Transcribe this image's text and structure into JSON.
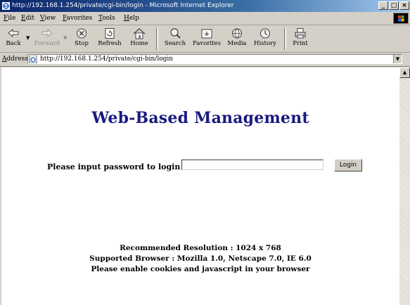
{
  "window": {
    "title": "http://192.168.1.254/private/cgi-bin/login - Microsoft Internet Explorer",
    "minimize": "_",
    "maximize": "□",
    "close": "×"
  },
  "menubar": {
    "items": [
      {
        "first": "F",
        "rest": "ile"
      },
      {
        "first": "E",
        "rest": "dit"
      },
      {
        "first": "V",
        "rest": "iew"
      },
      {
        "first": "F",
        "rest": "avorites"
      },
      {
        "first": "T",
        "rest": "ools"
      },
      {
        "first": "H",
        "rest": "elp"
      }
    ]
  },
  "toolbar": {
    "back": "Back",
    "forward": "Forward",
    "stop": "Stop",
    "refresh": "Refresh",
    "home": "Home",
    "search": "Search",
    "favorites": "Favorites",
    "media": "Media",
    "history": "History",
    "print": "Print"
  },
  "address": {
    "label_first": "A",
    "label_rest": "ddress",
    "url": "http://192.168.1.254/private/cgi-bin/login"
  },
  "page": {
    "heading": "Web-Based Management",
    "login_label": "Please input password to login :",
    "password_value": "",
    "login_button": "Login",
    "resolution": "Recommended Resolution : 1024 x 768",
    "browsers": "Supported Browser : Mozilla 1.0, Netscape 7.0, IE 6.0",
    "cookies": "Please enable cookies and javascript in your browser"
  },
  "colors": {
    "heading": "#1a1a80",
    "titlebar_start": "#0a246a",
    "chrome": "#d4d0c8"
  }
}
